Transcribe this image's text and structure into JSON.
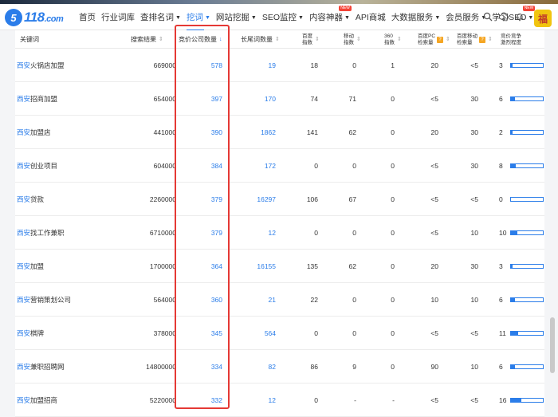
{
  "site": {
    "logo_mark": "5",
    "logo_text": "118",
    "logo_domain": ".com"
  },
  "menu": [
    {
      "label": "首页",
      "caret": false,
      "active": false,
      "badge": ""
    },
    {
      "label": "行业词库",
      "caret": false,
      "active": false,
      "badge": ""
    },
    {
      "label": "查排名词",
      "caret": true,
      "active": false,
      "badge": ""
    },
    {
      "label": "挖词",
      "caret": true,
      "active": true,
      "badge": ""
    },
    {
      "label": "网站挖掘",
      "caret": true,
      "active": false,
      "badge": ""
    },
    {
      "label": "SEO监控",
      "caret": true,
      "active": false,
      "badge": ""
    },
    {
      "label": "内容神器",
      "caret": true,
      "active": false,
      "badge": "NEW"
    },
    {
      "label": "API商城",
      "caret": false,
      "active": false,
      "badge": ""
    },
    {
      "label": "大数据服务",
      "caret": true,
      "active": false,
      "badge": ""
    },
    {
      "label": "会员服务",
      "caret": true,
      "active": false,
      "badge": ""
    },
    {
      "label": "学习SEO",
      "caret": true,
      "active": false,
      "badge": "NEW"
    }
  ],
  "nav_icons": [
    "search-icon",
    "cloud-download-icon",
    "notification-bell-icon"
  ],
  "avatar_text": "福",
  "headers": {
    "keyword": "关键词",
    "search_results": "搜索结果",
    "bid_companies": "竞价公司数量",
    "longtail": "长尾词数量",
    "baidu_index": "百度\n指数",
    "mobile_index": "移动\n指数",
    "index_360": "360\n指数",
    "baidu_pc": "百度PC\n检索量",
    "baidu_mobile": "百度移动\n检索量",
    "competition": "竞价竞争\n激烈程度"
  },
  "rows": [
    {
      "prefix": "西安",
      "rest": "火锅店加盟",
      "search": "669000",
      "bid": "578",
      "longtail": "19",
      "baidu": "18",
      "mobile": "0",
      "i360": "1",
      "pc": "20",
      "mob": "<5",
      "comp": "3",
      "comp_level": 0.06
    },
    {
      "prefix": "西安",
      "rest": "招商加盟",
      "search": "654000",
      "bid": "397",
      "longtail": "170",
      "baidu": "74",
      "mobile": "71",
      "i360": "0",
      "pc": "<5",
      "mob": "30",
      "comp": "6",
      "comp_level": 0.12
    },
    {
      "prefix": "西安",
      "rest": "加盟店",
      "search": "441000",
      "bid": "390",
      "longtail": "1862",
      "baidu": "141",
      "mobile": "62",
      "i360": "0",
      "pc": "20",
      "mob": "30",
      "comp": "2",
      "comp_level": 0.04
    },
    {
      "prefix": "西安",
      "rest": "创业项目",
      "search": "604000",
      "bid": "384",
      "longtail": "172",
      "baidu": "0",
      "mobile": "0",
      "i360": "0",
      "pc": "<5",
      "mob": "30",
      "comp": "8",
      "comp_level": 0.16
    },
    {
      "prefix": "西安",
      "rest": "贷款",
      "search": "2260000",
      "bid": "379",
      "longtail": "16297",
      "baidu": "106",
      "mobile": "67",
      "i360": "0",
      "pc": "<5",
      "mob": "<5",
      "comp": "0",
      "comp_level": 0.0
    },
    {
      "prefix": "西安",
      "rest": "找工作兼职",
      "search": "6710000",
      "bid": "379",
      "longtail": "12",
      "baidu": "0",
      "mobile": "0",
      "i360": "0",
      "pc": "<5",
      "mob": "10",
      "comp": "10",
      "comp_level": 0.2
    },
    {
      "prefix": "西安",
      "rest": "加盟",
      "search": "1700000",
      "bid": "364",
      "longtail": "16155",
      "baidu": "135",
      "mobile": "62",
      "i360": "0",
      "pc": "20",
      "mob": "30",
      "comp": "3",
      "comp_level": 0.06
    },
    {
      "prefix": "西安",
      "rest": "营销策划公司",
      "search": "564000",
      "bid": "360",
      "longtail": "21",
      "baidu": "22",
      "mobile": "0",
      "i360": "0",
      "pc": "10",
      "mob": "10",
      "comp": "6",
      "comp_level": 0.12
    },
    {
      "prefix": "西安",
      "rest": "棋牌",
      "search": "378000",
      "bid": "345",
      "longtail": "564",
      "baidu": "0",
      "mobile": "0",
      "i360": "0",
      "pc": "<5",
      "mob": "<5",
      "comp": "11",
      "comp_level": 0.22
    },
    {
      "prefix": "西安",
      "rest": "兼职招聘网",
      "search": "14800000",
      "bid": "334",
      "longtail": "82",
      "baidu": "86",
      "mobile": "9",
      "i360": "0",
      "pc": "90",
      "mob": "10",
      "comp": "6",
      "comp_level": 0.12
    },
    {
      "prefix": "西安",
      "rest": "加盟招商",
      "search": "5220000",
      "bid": "332",
      "longtail": "12",
      "baidu": "0",
      "mobile": "-",
      "i360": "-",
      "pc": "<5",
      "mob": "<5",
      "comp": "16",
      "comp_level": 0.32
    }
  ],
  "colors": {
    "accent": "#2b7de9",
    "highlight_box": "#e53935",
    "badge": "#f44336"
  }
}
